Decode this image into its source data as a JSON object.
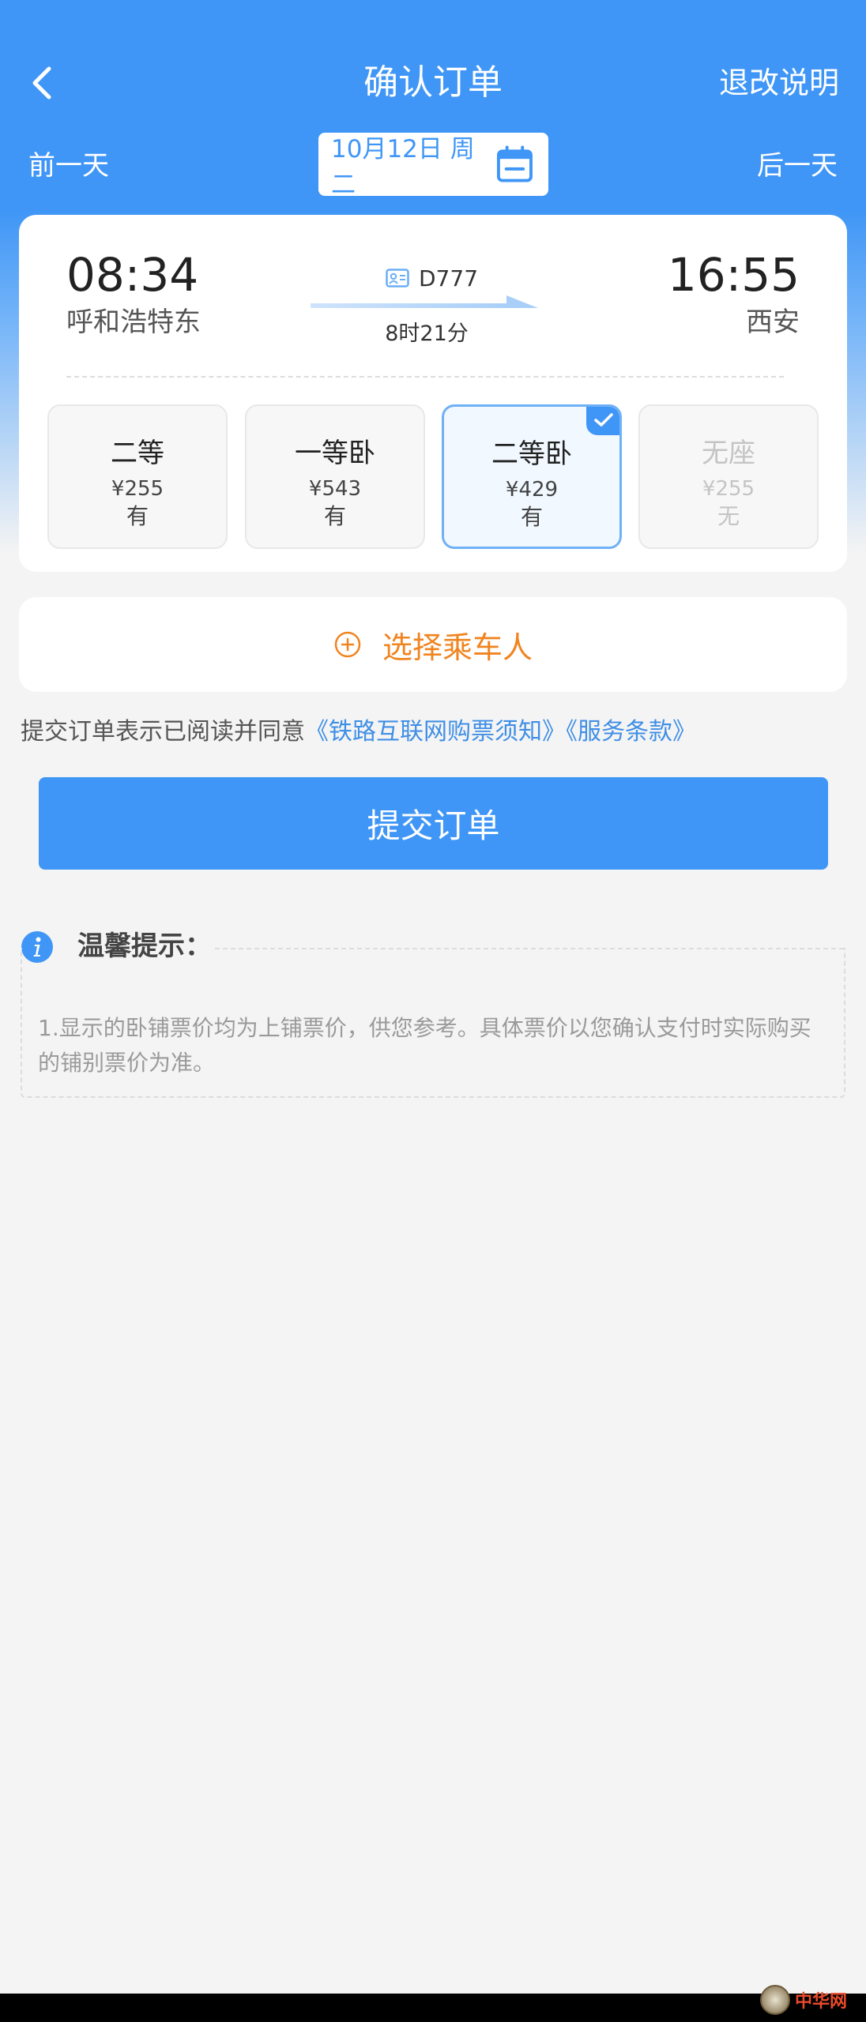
{
  "header": {
    "title": "确认订单",
    "refund_label": "退改说明"
  },
  "date_bar": {
    "prev_label": "前一天",
    "next_label": "后一天",
    "date_text": "10月12日 周二"
  },
  "train": {
    "dep_time": "08:34",
    "dep_station": "呼和浩特东",
    "arr_time": "16:55",
    "arr_station": "西安",
    "train_no": "D777",
    "duration": "8时21分"
  },
  "seats": [
    {
      "name": "二等",
      "price": "¥255",
      "avail": "有",
      "selected": false,
      "disabled": false
    },
    {
      "name": "一等卧",
      "price": "¥543",
      "avail": "有",
      "selected": false,
      "disabled": false
    },
    {
      "name": "二等卧",
      "price": "¥429",
      "avail": "有",
      "selected": true,
      "disabled": false
    },
    {
      "name": "无座",
      "price": "¥255",
      "avail": "无",
      "selected": false,
      "disabled": true
    }
  ],
  "passenger": {
    "label": "选择乘车人"
  },
  "agreement": {
    "prefix": "提交订单表示已阅读并同意",
    "link1": "《铁路互联网购票须知》",
    "link2": "《服务条款》"
  },
  "submit_label": "提交订单",
  "tips": {
    "title": "温馨提示：",
    "text": "1.显示的卧铺票价均为上铺票价，供您参考。具体票价以您确认支付时实际购买的铺别票价为准。"
  },
  "watermark": {
    "text": "中华网"
  },
  "colors": {
    "primary": "#3f96f6",
    "accent_orange": "#f0841f",
    "link": "#3f8fe6"
  }
}
